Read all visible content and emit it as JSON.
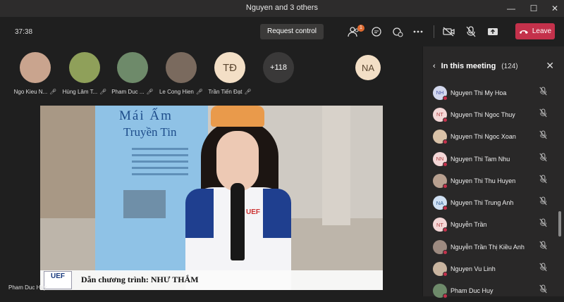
{
  "window": {
    "title": "Nguyen and 3 others"
  },
  "toolbar": {
    "time": "37:38",
    "request_control": "Request control",
    "participants_badge": "1",
    "leave": "Leave",
    "icons": [
      "people-icon",
      "chat-icon",
      "reactions-icon",
      "more-icon",
      "camera-off-icon",
      "mic-off-icon",
      "share-icon",
      "phone-icon"
    ]
  },
  "gallery": {
    "tiles": [
      {
        "name": "Ngo Kieu N...",
        "initials": "",
        "color": "#c9a48e"
      },
      {
        "name": "Hùng Lâm T...",
        "initials": "",
        "color": "#8fa05a"
      },
      {
        "name": "Pham Duc ...",
        "initials": "",
        "color": "#6e8a6a"
      },
      {
        "name": "Le Cong Hien",
        "initials": "",
        "color": "#7a6a5e"
      },
      {
        "name": "Trần Tiến Đạt",
        "initials": "TĐ",
        "color": "#f3dfc6"
      },
      {
        "name": "",
        "initials": "+118",
        "color": "#3a3939"
      },
      {
        "name": "",
        "initials": "NA",
        "color": "#f3dfc6"
      }
    ]
  },
  "stage": {
    "banner_line1": "Mái  Ấm",
    "banner_line2": "Truyền Tin",
    "caption_logo": "UEF",
    "caption": "Dẫn chương trình: NHƯ THẮM",
    "speaker": "Pham Duc Huy"
  },
  "panel": {
    "title": "In this meeting",
    "count": "(124)",
    "participants": [
      {
        "initials": "NH",
        "name": "Nguyen Thi My Hoa",
        "bg": "#d3d8ee",
        "fg": "#4a57a8"
      },
      {
        "initials": "NT",
        "name": "Nguyen Thi Ngoc Thuy",
        "bg": "#f4d7d7",
        "fg": "#b04545"
      },
      {
        "initials": "",
        "name": "Nguyen Thi Ngoc Xoan",
        "bg": "#d9c2a8",
        "fg": "#333"
      },
      {
        "initials": "NN",
        "name": "Nguyen Thi Tam Nhu",
        "bg": "#f4d7d7",
        "fg": "#b04545"
      },
      {
        "initials": "",
        "name": "Nguyen Thi Thu Huyen",
        "bg": "#b8a090",
        "fg": "#333"
      },
      {
        "initials": "NA",
        "name": "Nguyen Thi Trung Anh",
        "bg": "#cfe0f3",
        "fg": "#2f5d92"
      },
      {
        "initials": "NT",
        "name": "Nguyễn Trần",
        "bg": "#f4d7d7",
        "fg": "#b04545"
      },
      {
        "initials": "",
        "name": "Nguyễn Trần Thị Kiều Anh",
        "bg": "#9d8a80",
        "fg": "#333"
      },
      {
        "initials": "",
        "name": "Nguyen Vu Linh",
        "bg": "#c9b49f",
        "fg": "#333"
      },
      {
        "initials": "",
        "name": "Pham Duc Huy",
        "bg": "#6e8a6a",
        "fg": "#333"
      }
    ]
  }
}
